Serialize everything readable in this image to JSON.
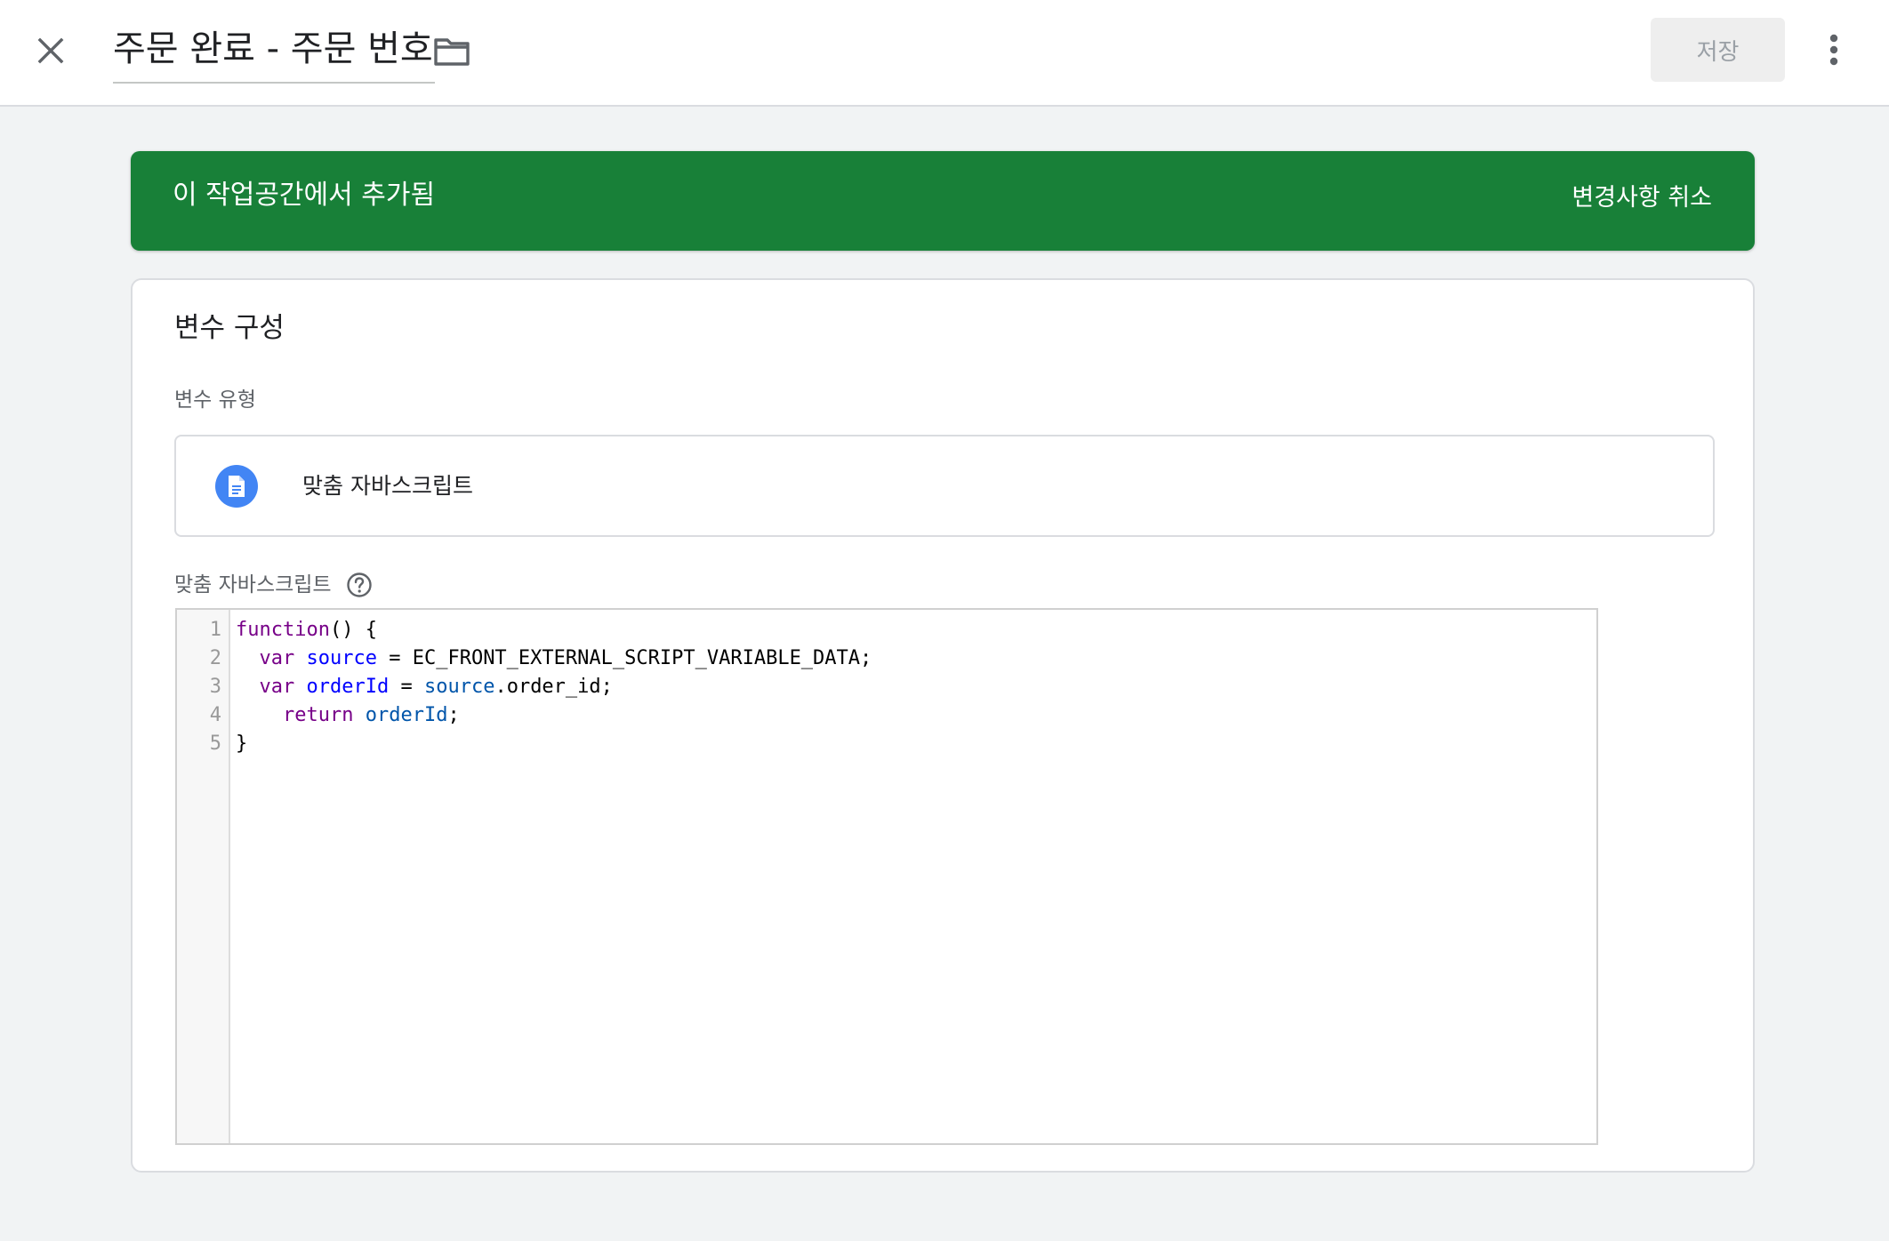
{
  "header": {
    "title": "주문 완료 - 주문 번호",
    "save_label": "저장"
  },
  "banner": {
    "message": "이 작업공간에서 추가됨",
    "action_label": "변경사항 취소",
    "color": "#188038"
  },
  "card": {
    "title": "변수 구성",
    "type_label": "변수 유형",
    "type_name": "맞춤 자바스크립트",
    "script_label": "맞춤 자바스크립트"
  },
  "editor": {
    "line_numbers": [
      "1",
      "2",
      "3",
      "4",
      "5"
    ],
    "lines": [
      [
        {
          "t": "function",
          "c": "kw"
        },
        {
          "t": "() {",
          "c": ""
        }
      ],
      [
        {
          "t": "  ",
          "c": ""
        },
        {
          "t": "var",
          "c": "kw"
        },
        {
          "t": " ",
          "c": ""
        },
        {
          "t": "source",
          "c": "def"
        },
        {
          "t": " = EC_FRONT_EXTERNAL_SCRIPT_VARIABLE_DATA;",
          "c": ""
        }
      ],
      [
        {
          "t": "  ",
          "c": ""
        },
        {
          "t": "var",
          "c": "kw"
        },
        {
          "t": " ",
          "c": ""
        },
        {
          "t": "orderId",
          "c": "def"
        },
        {
          "t": " = ",
          "c": ""
        },
        {
          "t": "source",
          "c": "var"
        },
        {
          "t": ".order_id;",
          "c": ""
        }
      ],
      [
        {
          "t": "    ",
          "c": ""
        },
        {
          "t": "return",
          "c": "kw"
        },
        {
          "t": " ",
          "c": ""
        },
        {
          "t": "orderId",
          "c": "var"
        },
        {
          "t": ";",
          "c": ""
        }
      ],
      [
        {
          "t": "}",
          "c": ""
        }
      ]
    ]
  },
  "icons": {
    "close": "close-icon",
    "folder": "folder-icon",
    "more": "more-vert-icon",
    "type": "document-icon",
    "help": "help-icon"
  }
}
